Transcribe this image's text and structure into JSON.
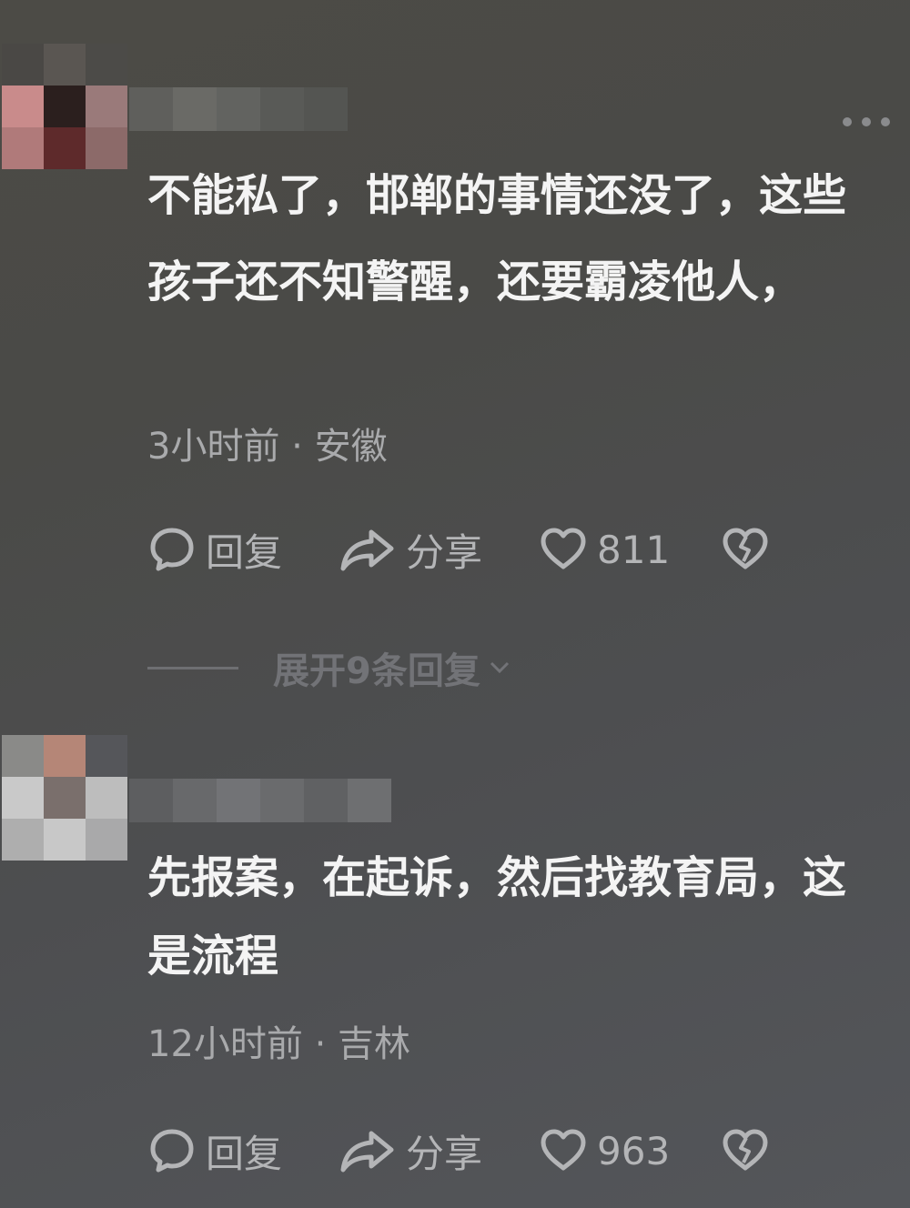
{
  "comments": [
    {
      "text": "不能私了，邯郸的事情还没了，这些孩子还不知警醒，还要霸凌他人，",
      "time_location": "3小时前 · 安徽",
      "reply_label": "回复",
      "share_label": "分享",
      "like_count": "811",
      "expand_label": "展开9条回复"
    },
    {
      "text": "先报案，在起诉，然后找教育局，这是流程",
      "time_location": "12小时前 · 吉林",
      "reply_label": "回复",
      "share_label": "分享",
      "like_count": "963"
    }
  ],
  "icons": {
    "more": "more-icon",
    "reply": "comment-bubble-icon",
    "share": "share-arrow-icon",
    "like": "heart-icon",
    "dislike": "broken-heart-icon",
    "expand": "chevron-down-icon"
  },
  "colors": {
    "background": "#4b4b48",
    "text": "#f4f4f4",
    "meta": "#a9aaac",
    "action": "#b4b5b7"
  }
}
